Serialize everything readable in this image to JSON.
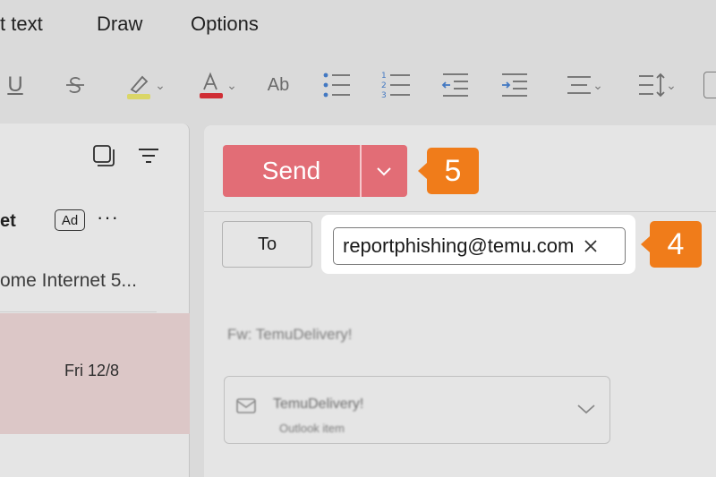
{
  "menu": {
    "format_text_partial": "t text",
    "draw": "Draw",
    "options": "Options"
  },
  "toolbar": {
    "icons": [
      "underline-icon",
      "strikethrough-icon",
      "highlight-icon",
      "font-color-icon",
      "clear-formatting-icon",
      "bullets-icon",
      "numbering-icon",
      "decrease-indent-icon",
      "increase-indent-icon",
      "align-icon",
      "line-spacing-icon"
    ],
    "highlight_color": "#f3ef73",
    "font_color": "#e8343c",
    "underline_label": "U",
    "clear_format_label": "Ab"
  },
  "message_list": {
    "sender_partial": "et",
    "ad_label": "Ad",
    "more_label": "···",
    "preview_partial": "ome Internet 5...",
    "date": "Fri 12/8"
  },
  "compose": {
    "send_label": "Send",
    "to_label": "To",
    "recipient": "reportphishing@temu.com",
    "subject": "Fw: TemuDelivery!",
    "attachment_name": "TemuDelivery!",
    "attachment_type": "Outlook item"
  },
  "callouts": {
    "step_send": "5",
    "step_recipient": "4",
    "color": "#f07c1a"
  },
  "colors": {
    "send_button": "#e26d76",
    "selected_row": "#f5dede"
  }
}
